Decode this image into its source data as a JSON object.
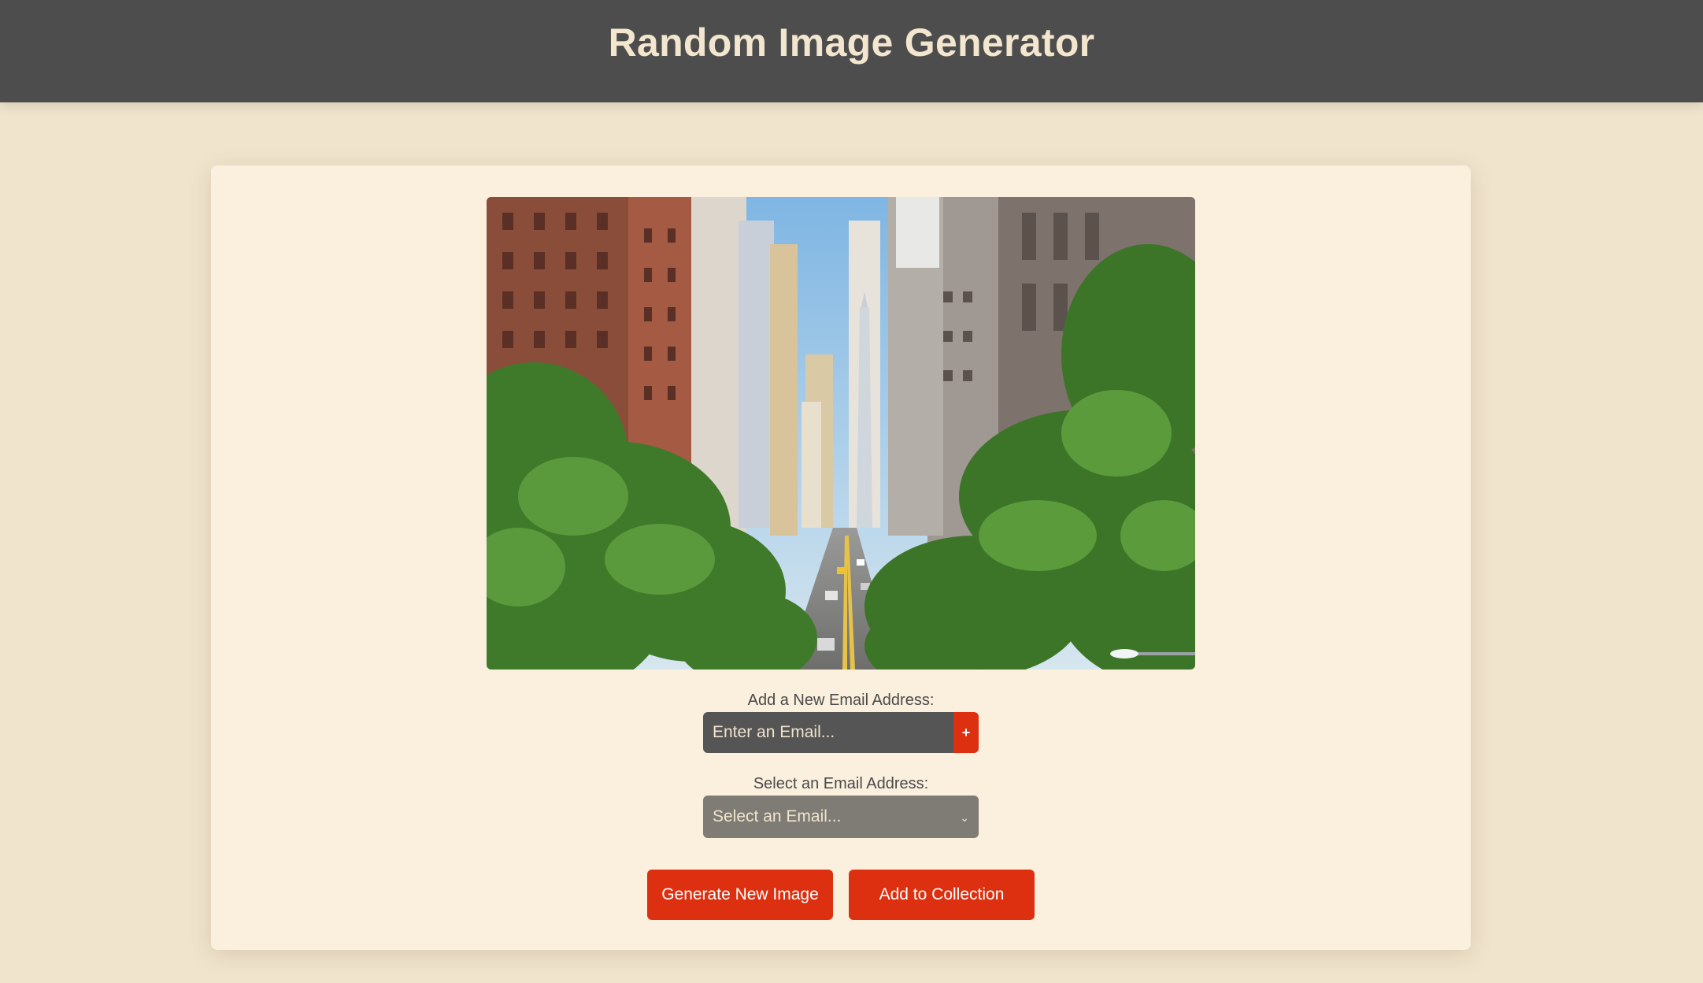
{
  "header": {
    "title": "Random Image Generator"
  },
  "image": {
    "alt": "city street with skyscrapers and trees"
  },
  "email_form": {
    "add_label": "Add a New Email Address:",
    "input_placeholder": "Enter an Email...",
    "add_button_label": "+",
    "select_label": "Select an Email Address:",
    "select_value": "Select an Email..."
  },
  "actions": {
    "generate_label": "Generate New Image",
    "collection_label": "Add to Collection"
  },
  "colors": {
    "header_bg": "#4d4d4d",
    "header_text": "#f3e6cf",
    "page_bg": "#f0e4cd",
    "card_bg": "#fbf0de",
    "accent": "#dc3010",
    "input_bg": "#555555",
    "select_bg": "#7f7c76"
  }
}
